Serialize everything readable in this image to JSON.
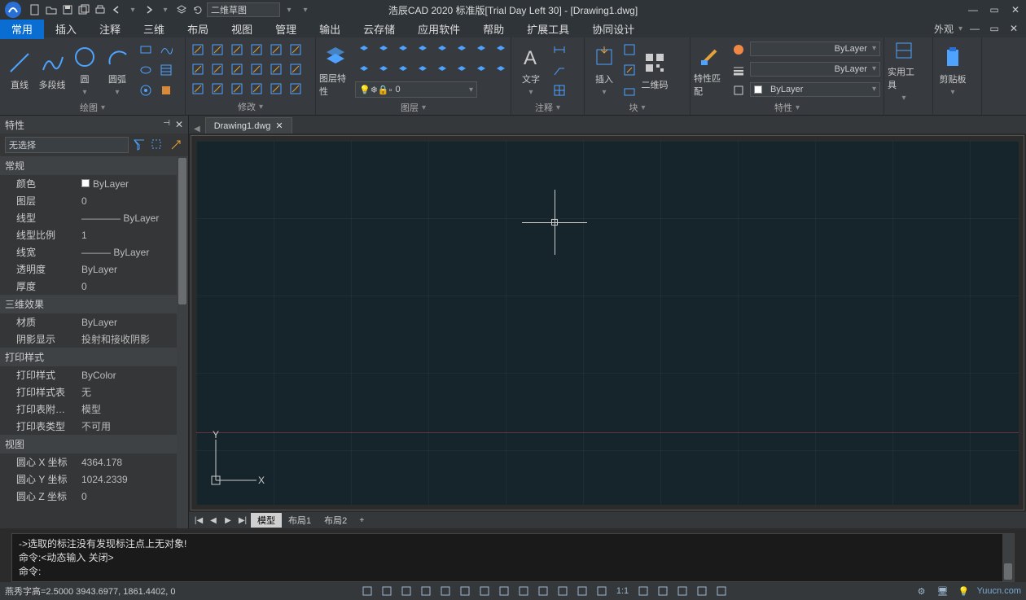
{
  "title": "浩辰CAD 2020 标准版[Trial Day Left 30] - [Drawing1.dwg]",
  "qat_input": "二维草图",
  "appearance_label": "外观",
  "menu": [
    "常用",
    "插入",
    "注释",
    "三维",
    "布局",
    "视图",
    "管理",
    "输出",
    "云存储",
    "应用软件",
    "帮助",
    "扩展工具",
    "协同设计"
  ],
  "menu_active": 0,
  "ribbon": {
    "draw": {
      "title": "绘图",
      "items": [
        "直线",
        "多段线",
        "圆",
        "圆弧"
      ]
    },
    "modify": {
      "title": "修改"
    },
    "layer": {
      "title": "图层",
      "bigs": [
        "图层特性"
      ],
      "combo": "0"
    },
    "text": {
      "title": "注释",
      "bigs": [
        "文字"
      ]
    },
    "insert": {
      "title": "块",
      "bigs": [
        "插入",
        "二维码"
      ]
    },
    "props": {
      "title": "特性",
      "bigs": [
        "特性匹配"
      ],
      "combos": [
        "ByLayer",
        "ByLayer",
        "ByLayer"
      ]
    },
    "utils": {
      "title": "",
      "bigs": [
        "实用工具"
      ]
    },
    "clip": {
      "title": "",
      "bigs": [
        "剪贴板"
      ]
    }
  },
  "props_panel": {
    "title": "特性",
    "selection": "无选择",
    "cats": [
      {
        "name": "常规",
        "rows": [
          {
            "k": "颜色",
            "v": "ByLayer",
            "color": "#fff"
          },
          {
            "k": "图层",
            "v": "0"
          },
          {
            "k": "线型",
            "v": "———— ByLayer"
          },
          {
            "k": "线型比例",
            "v": "1"
          },
          {
            "k": "线宽",
            "v": "——— ByLayer"
          },
          {
            "k": "透明度",
            "v": "ByLayer"
          },
          {
            "k": "厚度",
            "v": "0"
          }
        ]
      },
      {
        "name": "三维效果",
        "rows": [
          {
            "k": "材质",
            "v": "ByLayer"
          },
          {
            "k": "阴影显示",
            "v": "投射和接收阴影"
          }
        ]
      },
      {
        "name": "打印样式",
        "rows": [
          {
            "k": "打印样式",
            "v": "ByColor"
          },
          {
            "k": "打印样式表",
            "v": "无"
          },
          {
            "k": "打印表附…",
            "v": "模型"
          },
          {
            "k": "打印表类型",
            "v": "不可用"
          }
        ]
      },
      {
        "name": "视图",
        "rows": [
          {
            "k": "圆心 X 坐标",
            "v": "4364.178"
          },
          {
            "k": "圆心 Y 坐标",
            "v": "1024.2339"
          },
          {
            "k": "圆心 Z 坐标",
            "v": "0"
          }
        ]
      }
    ]
  },
  "doc_tab": "Drawing1.dwg",
  "layout_tabs": [
    "模型",
    "布局1",
    "布局2"
  ],
  "layout_active": 0,
  "ucs": {
    "x": "X",
    "y": "Y"
  },
  "cmd": {
    "lines": [
      "->选取的标注没有发现标注点上无对象!",
      "命令:<动态输入 关闭>",
      "命令:"
    ]
  },
  "status": {
    "left": "燕秀字高=2.5000  3943.6977, 1861.4402, 0",
    "ratio": "1:1",
    "right_brand": "Yuucn.com"
  }
}
